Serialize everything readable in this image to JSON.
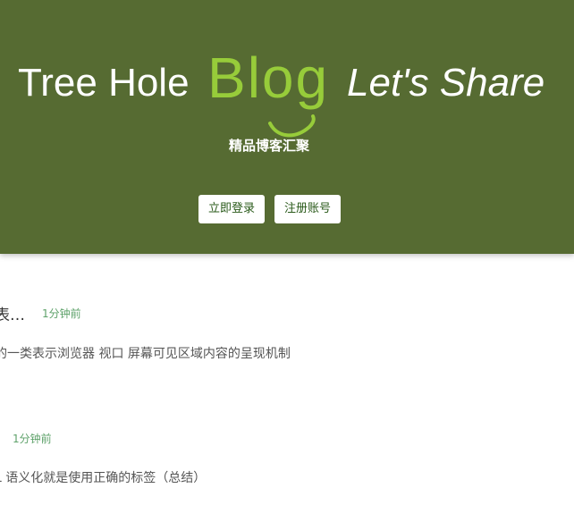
{
  "header": {
    "brand_left": "Tree Hole",
    "brand_blog": "Blog",
    "brand_right": "Let's Share",
    "subtitle": "精品博客汇聚",
    "login_label": "立即登录",
    "register_label": "注册账号",
    "colors": {
      "background": "#566b32",
      "accent": "#97cc3a"
    }
  },
  "posts": [
    {
      "title": "表…",
      "time": "1分钟前",
      "excerpt": "的一类表示浏览器 视口 屏幕可见区域内容的呈现机制"
    },
    {
      "title": "",
      "time": "1分钟前",
      "excerpt": "L 语义化就是使用正确的标签（总结）"
    }
  ]
}
